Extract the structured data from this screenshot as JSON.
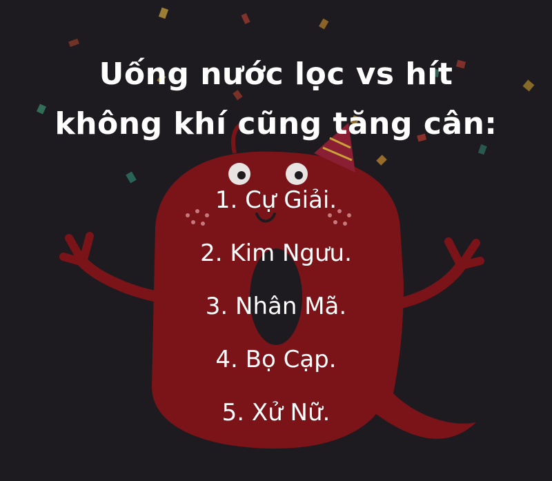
{
  "title": {
    "line1": "Uống nước lọc vs hít",
    "line2": "không khí cũng tăng cân:"
  },
  "items": [
    "1. Cự Giải.",
    "2. Kim Ngưu.",
    "3. Nhân Mã.",
    "4. Bọ Cạp.",
    "5. Xử Nữ."
  ],
  "colors": {
    "background": "#1d1b20",
    "monster": "#7a1418",
    "text": "#ffffff"
  }
}
